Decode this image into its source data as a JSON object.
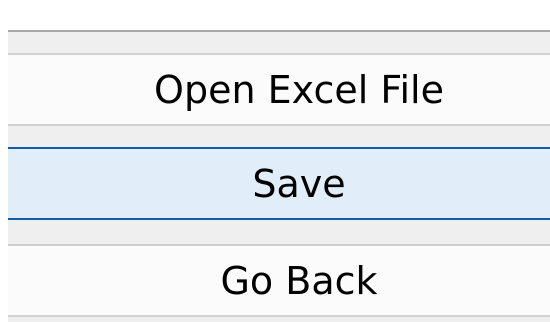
{
  "menu": {
    "items": [
      {
        "label": "Open Excel File",
        "selected": false
      },
      {
        "label": "Save",
        "selected": true
      },
      {
        "label": "Go Back",
        "selected": false
      }
    ]
  },
  "colors": {
    "selected_bg": "#e1edf8",
    "selected_border": "#0f5da8",
    "button_bg": "#fbfbfb",
    "button_border": "#d0d0d0"
  }
}
